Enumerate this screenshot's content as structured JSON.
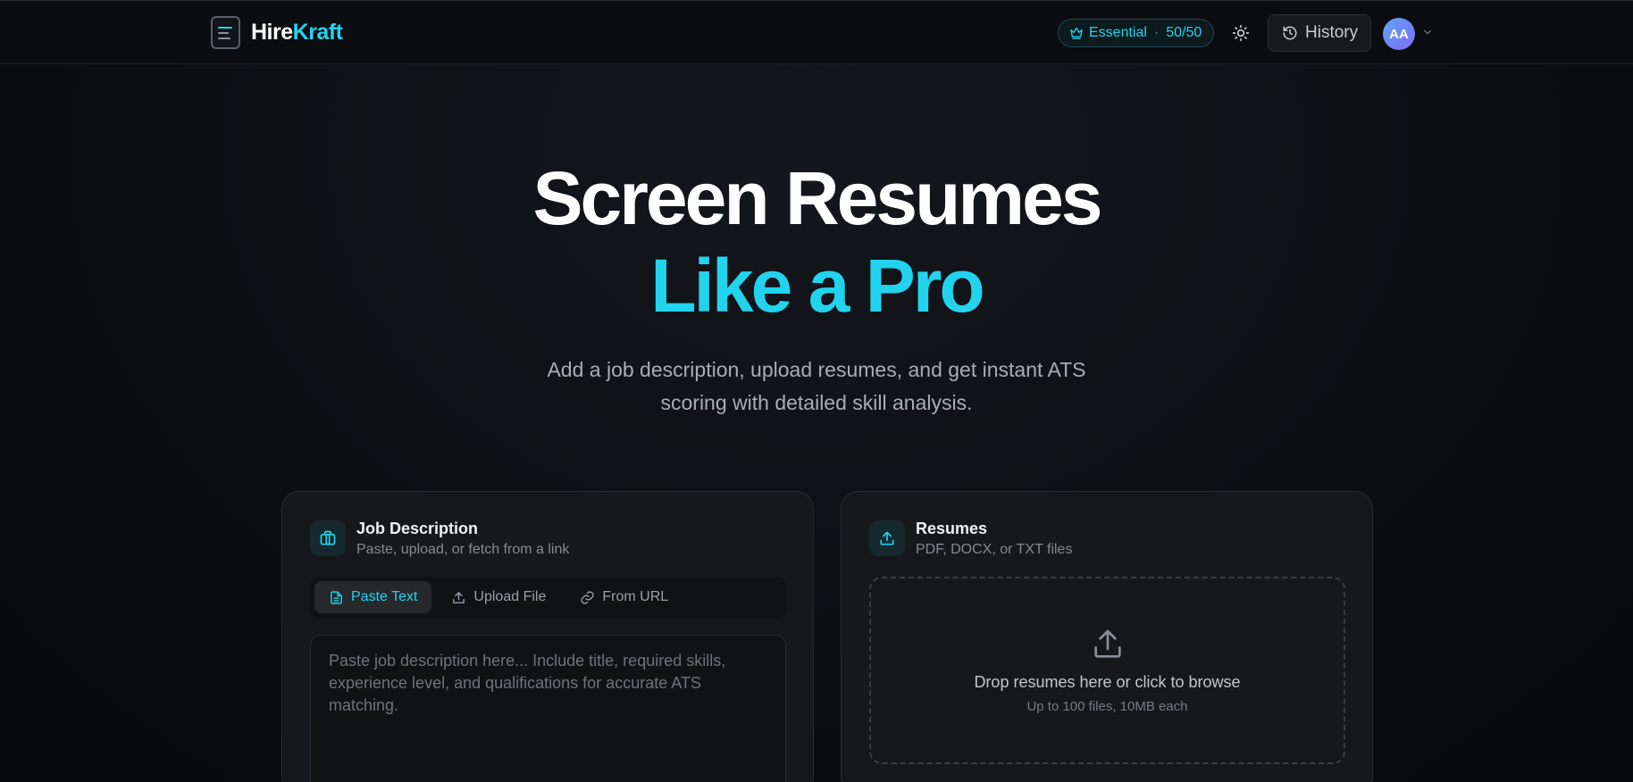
{
  "brand": {
    "name_part1": "Hire",
    "name_part2": "Kraft"
  },
  "header": {
    "plan_name": "Essential",
    "plan_separator": "·",
    "plan_usage": "50/50",
    "history_label": "History",
    "avatar_initials": "AA"
  },
  "hero": {
    "title_line1": "Screen Resumes",
    "title_line2": "Like a Pro",
    "subtitle": "Add a job description, upload resumes, and get instant ATS scoring with detailed skill analysis."
  },
  "job_card": {
    "title": "Job Description",
    "subtitle": "Paste, upload, or fetch from a link",
    "tabs": [
      {
        "label": "Paste Text",
        "icon": "document-icon",
        "active": true
      },
      {
        "label": "Upload File",
        "icon": "upload-icon",
        "active": false
      },
      {
        "label": "From URL",
        "icon": "link-icon",
        "active": false
      }
    ],
    "textarea_placeholder": "Paste job description here... Include title, required skills, experience level, and qualifications for accurate ATS matching."
  },
  "resume_card": {
    "title": "Resumes",
    "subtitle": "PDF, DOCX, or TXT files",
    "drop_main": "Drop resumes here or click to browse",
    "drop_sub": "Up to 100 files, 10MB each"
  },
  "colors": {
    "accent": "#22d3ee",
    "background": "#0c0e12",
    "card": "#17181b"
  }
}
